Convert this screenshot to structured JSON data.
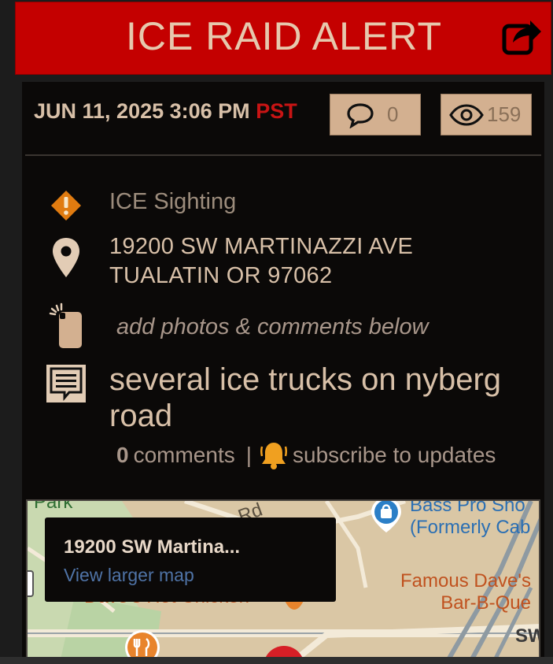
{
  "header": {
    "title": "ICE RAID ALERT",
    "share_icon": "share-icon",
    "background": "#c40000"
  },
  "alert": {
    "date": "JUN 11, 2025 3:06 PM",
    "timezone": "PST",
    "comments_count": "0",
    "views_count": "159",
    "type": "ICE Sighting",
    "address_line1": "19200 SW MARTINAZZI AVE",
    "address_line2": "TUALATIN OR 97062",
    "photo_hint": "add photos & comments below",
    "description": "several ice trucks on nyberg road",
    "comments_label_count": "0",
    "comments_label": "comments",
    "separator": "|",
    "subscribe_label": "subscribe to updates"
  },
  "map": {
    "popup_title": "19200 SW Martina...",
    "popup_link": "View larger map",
    "labels": {
      "park": "Park",
      "road": "Rd",
      "bass_pro_line1": "Bass Pro Sho",
      "bass_pro_line2": "(Formerly Cab",
      "famous_daves_line1": "Famous Dave's",
      "famous_daves_line2": "Bar-B-Que",
      "chicken": "Dave's Hot Chicken",
      "street": "SW"
    }
  },
  "icons": [
    "share-icon",
    "comment-icon",
    "eye-icon",
    "warning-icon",
    "location-pin-icon",
    "phone-camera-icon",
    "message-icon",
    "bell-icon"
  ],
  "colors": {
    "accent_red": "#c40000",
    "text_tan": "#d8c0a8",
    "timezone_red": "#c81414",
    "warning_orange": "#e07b10",
    "bell_orange": "#f0a020",
    "link_blue": "#4f73a6"
  }
}
